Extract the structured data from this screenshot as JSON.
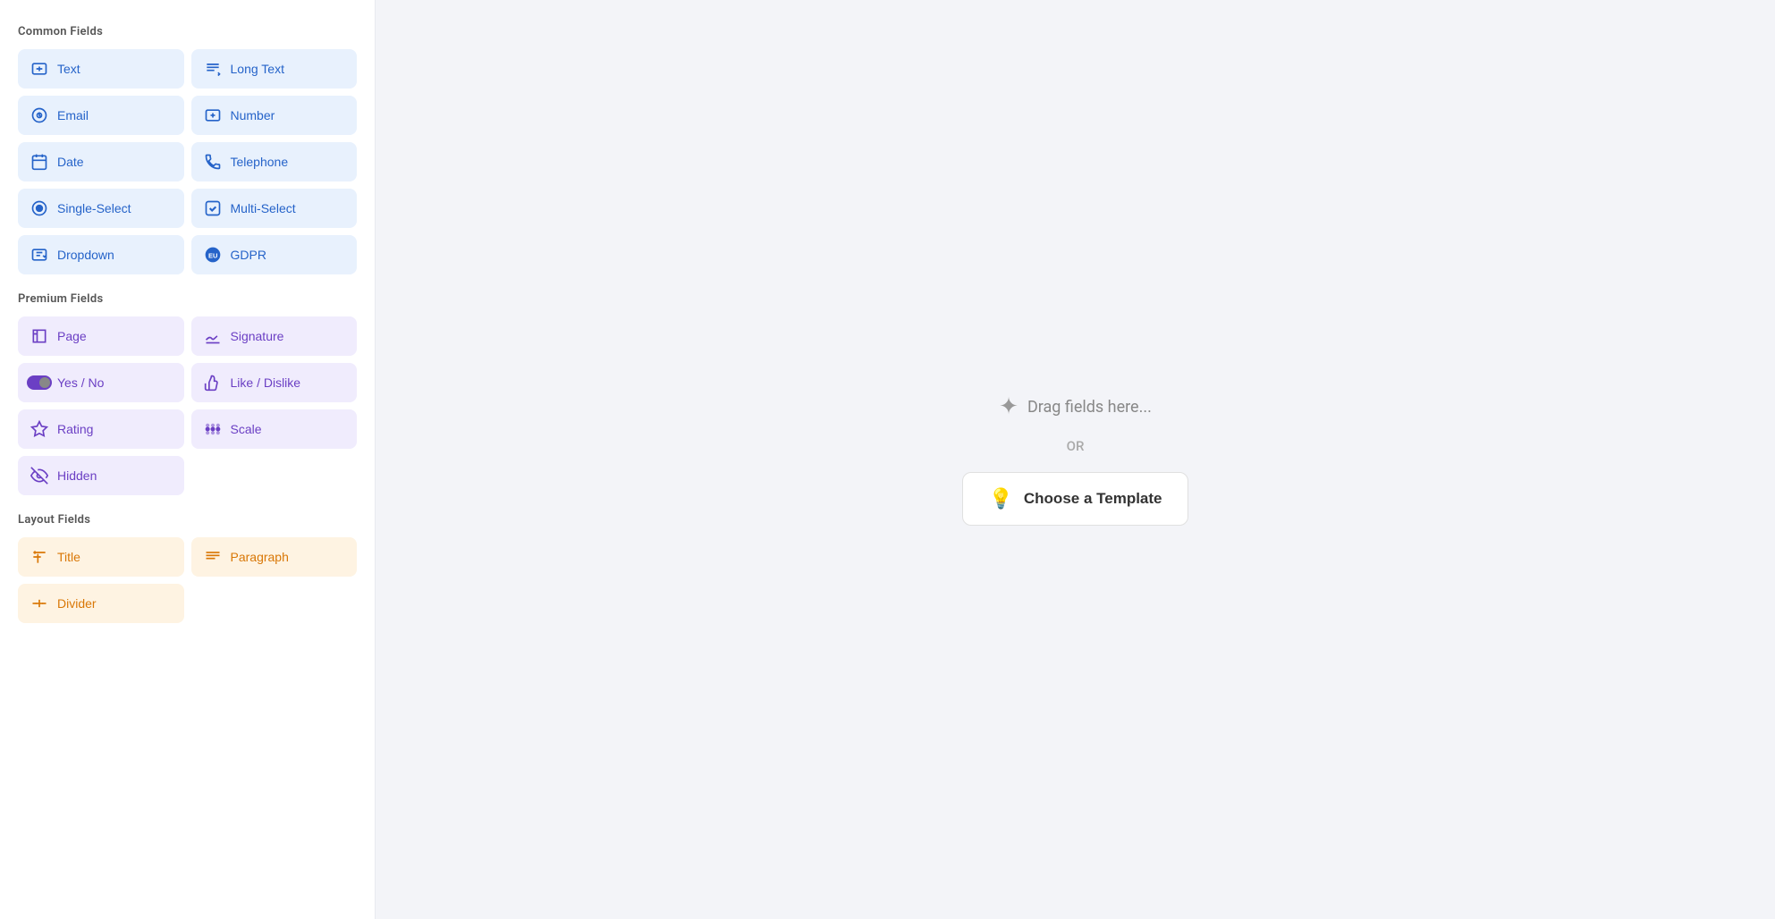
{
  "sidebar": {
    "common_fields_label": "Common Fields",
    "premium_fields_label": "Premium Fields",
    "layout_fields_label": "Layout Fields",
    "common_fields": [
      {
        "id": "text",
        "label": "Text",
        "icon": "text"
      },
      {
        "id": "long-text",
        "label": "Long Text",
        "icon": "long-text"
      },
      {
        "id": "email",
        "label": "Email",
        "icon": "email"
      },
      {
        "id": "number",
        "label": "Number",
        "icon": "number"
      },
      {
        "id": "date",
        "label": "Date",
        "icon": "date"
      },
      {
        "id": "telephone",
        "label": "Telephone",
        "icon": "telephone"
      },
      {
        "id": "single-select",
        "label": "Single-Select",
        "icon": "single-select"
      },
      {
        "id": "multi-select",
        "label": "Multi-Select",
        "icon": "multi-select"
      },
      {
        "id": "dropdown",
        "label": "Dropdown",
        "icon": "dropdown"
      },
      {
        "id": "gdpr",
        "label": "GDPR",
        "icon": "gdpr"
      }
    ],
    "premium_fields": [
      {
        "id": "page",
        "label": "Page",
        "icon": "page"
      },
      {
        "id": "signature",
        "label": "Signature",
        "icon": "signature"
      },
      {
        "id": "yes-no",
        "label": "Yes / No",
        "icon": "yes-no"
      },
      {
        "id": "like-dislike",
        "label": "Like / Dislike",
        "icon": "like-dislike"
      },
      {
        "id": "rating",
        "label": "Rating",
        "icon": "rating"
      },
      {
        "id": "scale",
        "label": "Scale",
        "icon": "scale"
      },
      {
        "id": "hidden",
        "label": "Hidden",
        "icon": "hidden"
      }
    ],
    "layout_fields": [
      {
        "id": "title",
        "label": "Title",
        "icon": "title"
      },
      {
        "id": "paragraph",
        "label": "Paragraph",
        "icon": "paragraph"
      },
      {
        "id": "divider",
        "label": "Divider",
        "icon": "divider"
      }
    ]
  },
  "canvas": {
    "drag_hint": "Drag fields here...",
    "or_label": "OR",
    "choose_template_label": "Choose a Template"
  }
}
